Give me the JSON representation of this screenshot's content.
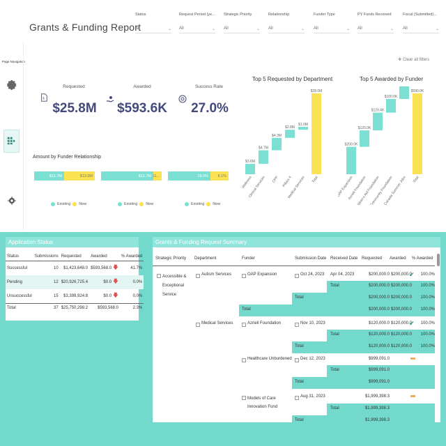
{
  "title": "Grants & Funding Report",
  "filters": [
    {
      "label": "Status",
      "value": "All"
    },
    {
      "label": "Request Period (ye...",
      "value": "All"
    },
    {
      "label": "Strategic Priority",
      "value": "All"
    },
    {
      "label": "Relationship",
      "value": "All"
    },
    {
      "label": "Funder Type",
      "value": "All"
    },
    {
      "label": "PY Funds Received",
      "value": "All"
    },
    {
      "label": "Fiscal (Submitted)...",
      "value": "All"
    }
  ],
  "nav": {
    "label": "Page Navigation"
  },
  "clear_filters": "Clear all filters",
  "kpis": {
    "requested": {
      "label": "Requested",
      "value": "$25.8M"
    },
    "awarded": {
      "label": "Awarded",
      "value": "$593.6K"
    },
    "success": {
      "label": "Success Rate",
      "value": "27.0%"
    }
  },
  "relationship": {
    "title": "Amount by Funder Relationship",
    "bars": [
      {
        "existing_label": "$12.7M",
        "new_label": "$13.0M",
        "existing_share": 0.49
      },
      {
        "existing_label": "$12.7M",
        "new_label": "$1...",
        "existing_share": 0.86
      },
      {
        "existing_label": "18.9%",
        "new_label": "8.1%",
        "existing_share": 0.7
      }
    ],
    "legend_existing": "Existing",
    "legend_new": "New",
    "colors": {
      "existing": "#7be0d3",
      "new": "#fbe253"
    }
  },
  "chart_data": [
    {
      "type": "bar",
      "subtype": "waterfall",
      "title": "Top 5 Requested by Department",
      "categories": [
        "Wellness",
        "Clinical Services",
        "CPP",
        "Pillars 4",
        "Medical Services",
        "Total"
      ],
      "values": [
        3.6,
        4.7,
        4.3,
        2.8,
        1.0,
        28.0
      ],
      "labels": [
        "$3.6M",
        "$4.7M",
        "$4.3M",
        "$2.8M",
        "$1.0M",
        "$28.0M"
      ]
    },
    {
      "type": "bar",
      "subtype": "waterfall",
      "title": "Top 5 Awarded by Funder",
      "categories": [
        "OAP Expansion",
        "Azrieli Foundation",
        "Children's Aid Foundation",
        "Community Foundation",
        "Canada Summer Jobs",
        "Total"
      ],
      "values": [
        200.0,
        120.0,
        129.4,
        100.0,
        100.0,
        590.0
      ],
      "labels": [
        "$200.0K",
        "$120.0K",
        "$129.4K",
        "$100.0K",
        "$100.0K",
        "$590.0K"
      ]
    }
  ],
  "application_status": {
    "title": "Application Status",
    "headers": [
      "Status",
      "Submissions",
      "Requested",
      "Awarded",
      "% Awarded"
    ],
    "rows": [
      {
        "status": "Successful",
        "submissions": "10",
        "requested": "$1,423,648.0",
        "awarded": "$593,568.0",
        "pct": "41.7%"
      },
      {
        "status": "Pending",
        "submissions": "12",
        "requested": "$20,926,725.4",
        "awarded": "$0.0",
        "pct": "0.0%"
      },
      {
        "status": "Unsuccessful",
        "submissions": "15",
        "requested": "$3,399,924.8",
        "awarded": "$0.0",
        "pct": "0.0%"
      }
    ],
    "total": {
      "status": "Total",
      "submissions": "37",
      "requested": "$25,750,298.2",
      "awarded": "$593,568.0",
      "pct": "2.3%"
    }
  },
  "summary": {
    "title": "Grants & Funding Request Summary",
    "headers": [
      "Strategic Priority",
      "Department",
      "Funder",
      "Submission Date",
      "Received Date",
      "Requested",
      "Awarded",
      "% Awarded"
    ],
    "priority": "Accessible & Exceptional Service",
    "dept1": "Autism Services",
    "dept2": "Medical Services",
    "rows": {
      "oap": {
        "funder": "OAP Expansion",
        "sub": "Oct 24, 2023",
        "rec": "Apr 04, 2023",
        "req": "$200,000.0",
        "awd": "$200,000.0",
        "pct": "100.0%"
      },
      "oap_total_a": {
        "label": "Total",
        "req": "$200,000.0",
        "awd": "$200,000.0",
        "pct": "100.0%"
      },
      "oap_total_b": {
        "label": "Total",
        "req": "$200,000.0",
        "awd": "$200,000.0",
        "pct": "100.0%"
      },
      "autism_total": {
        "label": "Total",
        "req": "$200,000.0",
        "awd": "$200,000.0",
        "pct": "100.0%"
      },
      "azrieli": {
        "funder": "Azrieli Foundation",
        "sub": "Nov 10, 2023",
        "rec": "",
        "req": "$120,000.0",
        "awd": "$120,000.0",
        "pct": "100.0%"
      },
      "az_total_a": {
        "label": "Total",
        "req": "$120,000.0",
        "awd": "$120,000.0",
        "pct": "100.0%"
      },
      "az_total_b": {
        "label": "Total",
        "req": "$120,000.0",
        "awd": "$120,000.0",
        "pct": "100.0%"
      },
      "healthcare": {
        "funder": "Healthcare Unburdened",
        "sub": "Dec 12, 2023",
        "rec": "",
        "req": "$999,091.0",
        "awd": "",
        "pct": ""
      },
      "hc_total": {
        "label": "Total",
        "req": "$999,091.0",
        "awd": "",
        "pct": ""
      },
      "hc_total_b": {
        "label": "Total",
        "req": "$999,091.0",
        "awd": "",
        "pct": ""
      },
      "models": {
        "funder": "Models of Care Innovation Fund",
        "sub": "Aug 31, 2023",
        "rec": "",
        "req": "$1,999,398.3",
        "awd": "",
        "pct": ""
      },
      "models_total": {
        "label": "Total",
        "req": "$1,999,398.3",
        "awd": "",
        "pct": ""
      },
      "last_total": {
        "label": "Total",
        "req": "$1,999,398.3"
      }
    }
  }
}
